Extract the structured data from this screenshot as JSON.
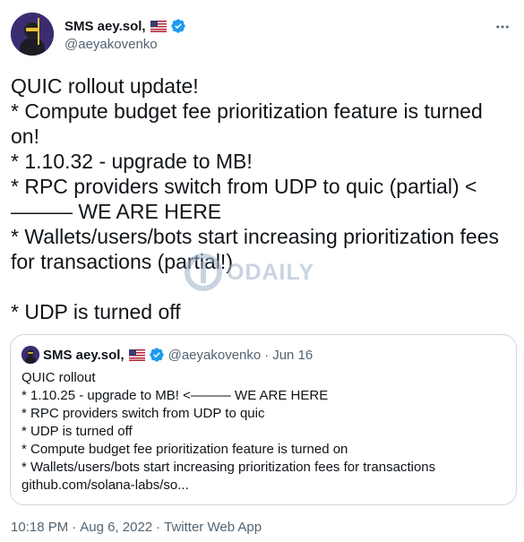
{
  "author": {
    "display_name": "SMS aey.sol,",
    "handle": "@aeyakovenko"
  },
  "tweet": {
    "text": "QUIC rollout update!\n* Compute budget fee prioritization feature is turned on!\n* 1.10.32 - upgrade to MB!\n* RPC providers switch from UDP to quic (partial) <——— WE ARE HERE\n* Wallets/users/bots start increasing prioritization fees for transactions (partial!)\n\n* UDP is turned off"
  },
  "watermark": {
    "text": "ODAILY"
  },
  "quoted_tweet": {
    "display_name": "SMS aey.sol,",
    "handle": "@aeyakovenko",
    "separator": "·",
    "date": "Jun 16",
    "text": "QUIC rollout\n* 1.10.25 - upgrade to MB! <——— WE ARE HERE\n* RPC providers switch from UDP to quic\n* UDP is turned off\n* Compute budget fee prioritization feature is turned on\n* Wallets/users/bots start increasing prioritization fees for transactions\ngithub.com/solana-labs/so..."
  },
  "meta": {
    "time": "10:18 PM",
    "date": "Aug 6, 2022",
    "source": "Twitter Web App",
    "separator": "·"
  },
  "icons": {
    "flag": "us-flag-icon",
    "verified": "verified-badge-icon",
    "more": "more-options-icon"
  },
  "colors": {
    "verified_blue": "#1d9bf0",
    "secondary_text": "#536471",
    "border": "#cfd9de"
  }
}
